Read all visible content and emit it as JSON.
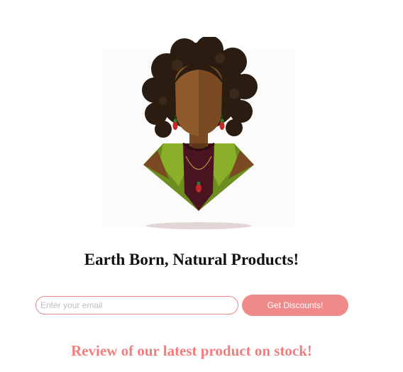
{
  "hero": {
    "icon": "woman-avatar-illustration"
  },
  "headline": "Earth Born, Natural Products!",
  "signup": {
    "email_placeholder": "Enter your email",
    "email_value": "",
    "button_label": "Get Discounts!"
  },
  "review": {
    "heading": "Review of our latest product on stock!"
  },
  "colors": {
    "accent": "#f08a8a",
    "review_text": "#f07e7e",
    "input_border": "#e8868b"
  }
}
